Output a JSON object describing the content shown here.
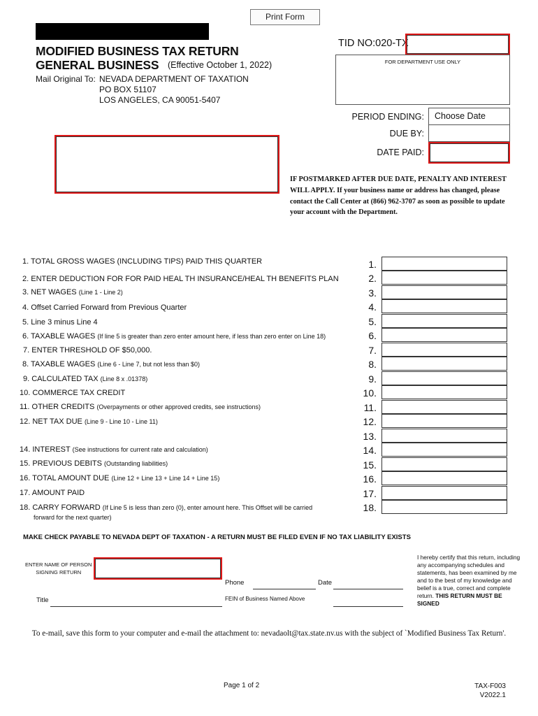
{
  "toolbar": {
    "print_label": "Print Form"
  },
  "header": {
    "title_line1": "MODIFIED BUSINESS TAX RETURN",
    "title_line2": "GENERAL BUSINESS",
    "effective": "(Effective October 1, 2022)",
    "mail_label": "Mail Original To:",
    "mail_address": [
      "NEVADA DEPARTMENT OF TAXATION",
      "PO BOX 51107",
      "LOS ANGELES, CA  90051-5407"
    ]
  },
  "tid": {
    "label": "TID NO:020-TX",
    "value": ""
  },
  "department": {
    "label": "FOR DEPARTMENT USE ONLY"
  },
  "dates": {
    "period_ending_label": "PERIOD ENDING:",
    "period_ending_value": "Choose Date",
    "due_by_label": "DUE BY:",
    "due_by_value": "",
    "date_paid_label": "DATE PAID:",
    "date_paid_value": ""
  },
  "notice": {
    "caps": "IF POSTMARKED AFTER DUE DATE, PENALTY AND INTEREST WILL APPLY.",
    "text": "If your business name or address has changed, please contact the Call Center at (866) 962-3707 as soon as possible to update your account with the Department."
  },
  "lines": [
    {
      "num": "1.",
      "label": "1. TOTAL GROSS WAGES (INCLUDING TIPS) PAID THIS QUARTER",
      "note": "",
      "value": ""
    },
    {
      "num": "2.",
      "label": "2. ENTER DEDUCTION FOR FOR PAID HEAL TH INSURANCE/HEAL TH BENEFITS PLAN",
      "note": "",
      "value": ""
    },
    {
      "num": "3.",
      "label": "3. NET WAGES",
      "note": "(Line 1 - Line 2)",
      "value": ""
    },
    {
      "num": "4.",
      "label": "4. Offset Carried Forward from Previous Quarter",
      "note": "",
      "value": ""
    },
    {
      "num": "5.",
      "label": "5. Line 3 minus Line 4",
      "note": "",
      "value": ""
    },
    {
      "num": "6.",
      "label": "6. TAXABLE WAGES",
      "note": "(If line 5 is greater than zero enter amount here, if less than zero enter on Line 18)",
      "value": ""
    },
    {
      "num": "7.",
      "label": "7. ENTER THRESHOLD OF $50,000.",
      "note": "",
      "value": ""
    },
    {
      "num": "8.",
      "label": "8. TAXABLE WAGES",
      "note": "(Line 6 - Line 7, but not less than $0)",
      "value": ""
    },
    {
      "num": "9.",
      "label": "9. CALCULATED TAX",
      "note": " (Line 8 x .01378)",
      "value": ""
    },
    {
      "num": "10.",
      "label": "10. COMMERCE TAX CREDIT",
      "note": "",
      "value": ""
    },
    {
      "num": "11.",
      "label": "11. OTHER CREDITS",
      "note": "(Overpayments or other approved credits, see instructions)",
      "value": ""
    },
    {
      "num": "12.",
      "label": "12. NET TAX DUE",
      "note": "(Line 9 - Line 10 - Line 11)",
      "value": ""
    },
    {
      "num": "13.",
      "label": "",
      "note": "",
      "value": ""
    },
    {
      "num": "14.",
      "label": "14. INTEREST",
      "note": "(See instructions for current rate and calculation)",
      "value": ""
    },
    {
      "num": "15.",
      "label": "15. PREVIOUS DEBITS",
      "note": "(Outstanding liabilities)",
      "value": ""
    },
    {
      "num": "16.",
      "label": "16. TOTAL AMOUNT DUE",
      "note": "(Line 12 + Line 13 + Line 14 + Line 15)",
      "value": ""
    },
    {
      "num": "17.",
      "label": "17. AMOUNT PAID",
      "note": "",
      "value": ""
    },
    {
      "num": "18.",
      "label": "18. CARRY FORWARD",
      "note": "(If Line 5 is less than zero (0), enter amount here. This Offset will be carried",
      "note2": "forward for the next quarter)",
      "value": ""
    }
  ],
  "check_note": "MAKE CHECK PAYABLE TO NEVADA DEPT OF TAXATION - A RETURN MUST BE FILED EVEN IF NO TAX LIABILITY EXISTS",
  "signature": {
    "signer_label_1": "ENTER NAME OF PERSON",
    "signer_label_2": "SIGNING RETURN",
    "signer_value": "",
    "phone_label": "Phone",
    "date_label": "Date",
    "title_label": "Title",
    "fein_label": "FEIN of Business Named Above",
    "certify_text": "I hereby certify that this return, including any accompanying schedules and statements, has been examined by me and to the best of my knowledge and belief is a true, correct and complete return.",
    "certify_bold": "THIS RETURN MUST BE SIGNED"
  },
  "footer": {
    "email_note": "To e-mail, save this form to your computer and e-mail the attachment to: nevadaolt@tax.state.nv.us with the subject of `Modified Business Tax Return'.",
    "page": "Page 1 of 2",
    "form_id": "TAX-F003",
    "version": "V2022.1"
  }
}
